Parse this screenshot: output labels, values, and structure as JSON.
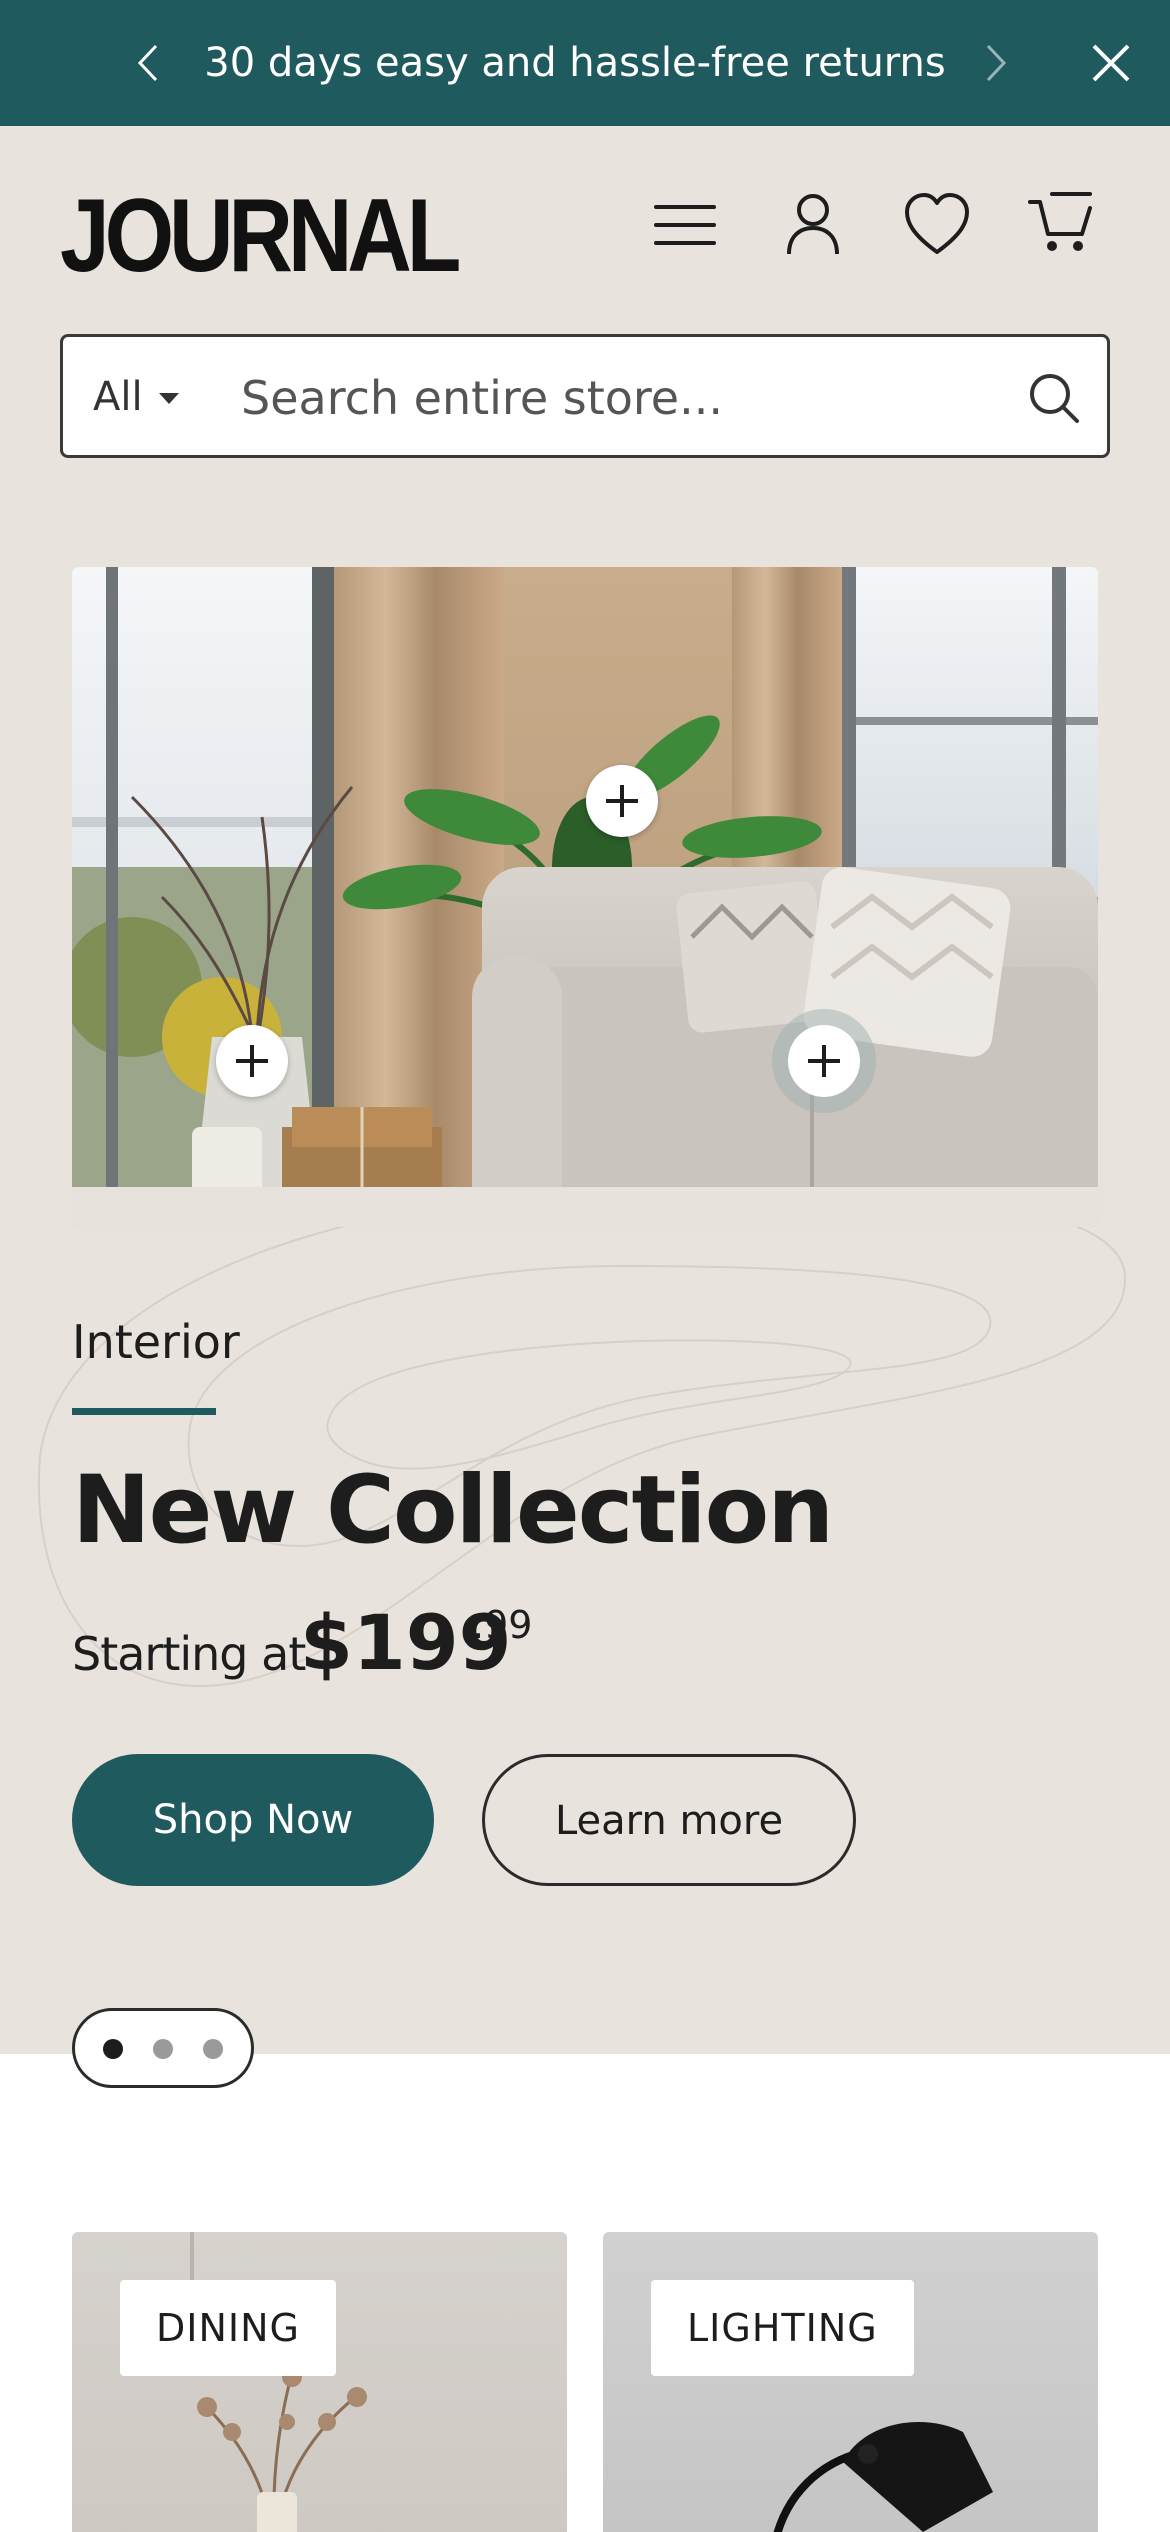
{
  "announcement": {
    "message": "30 days easy and hassle-free returns"
  },
  "header": {
    "logo": "JOURNAL"
  },
  "search": {
    "category": "All",
    "placeholder": "Search entire store..."
  },
  "hero": {
    "eyebrow": "Interior",
    "title": "New Collection",
    "price_lead": "Starting at",
    "price_whole": "$199",
    "price_cents": ".99",
    "primary_button": "Shop Now",
    "secondary_button": "Learn more",
    "accent_color": "#1f5a5e",
    "slide_count": 3,
    "active_slide": 1
  },
  "categories": [
    {
      "label": "DINING"
    },
    {
      "label": "LIGHTING"
    }
  ],
  "colors": {
    "announcement_bg": "#1f5a5e",
    "hero_bg": "#e8e4dd",
    "text": "#1d1d1d"
  }
}
